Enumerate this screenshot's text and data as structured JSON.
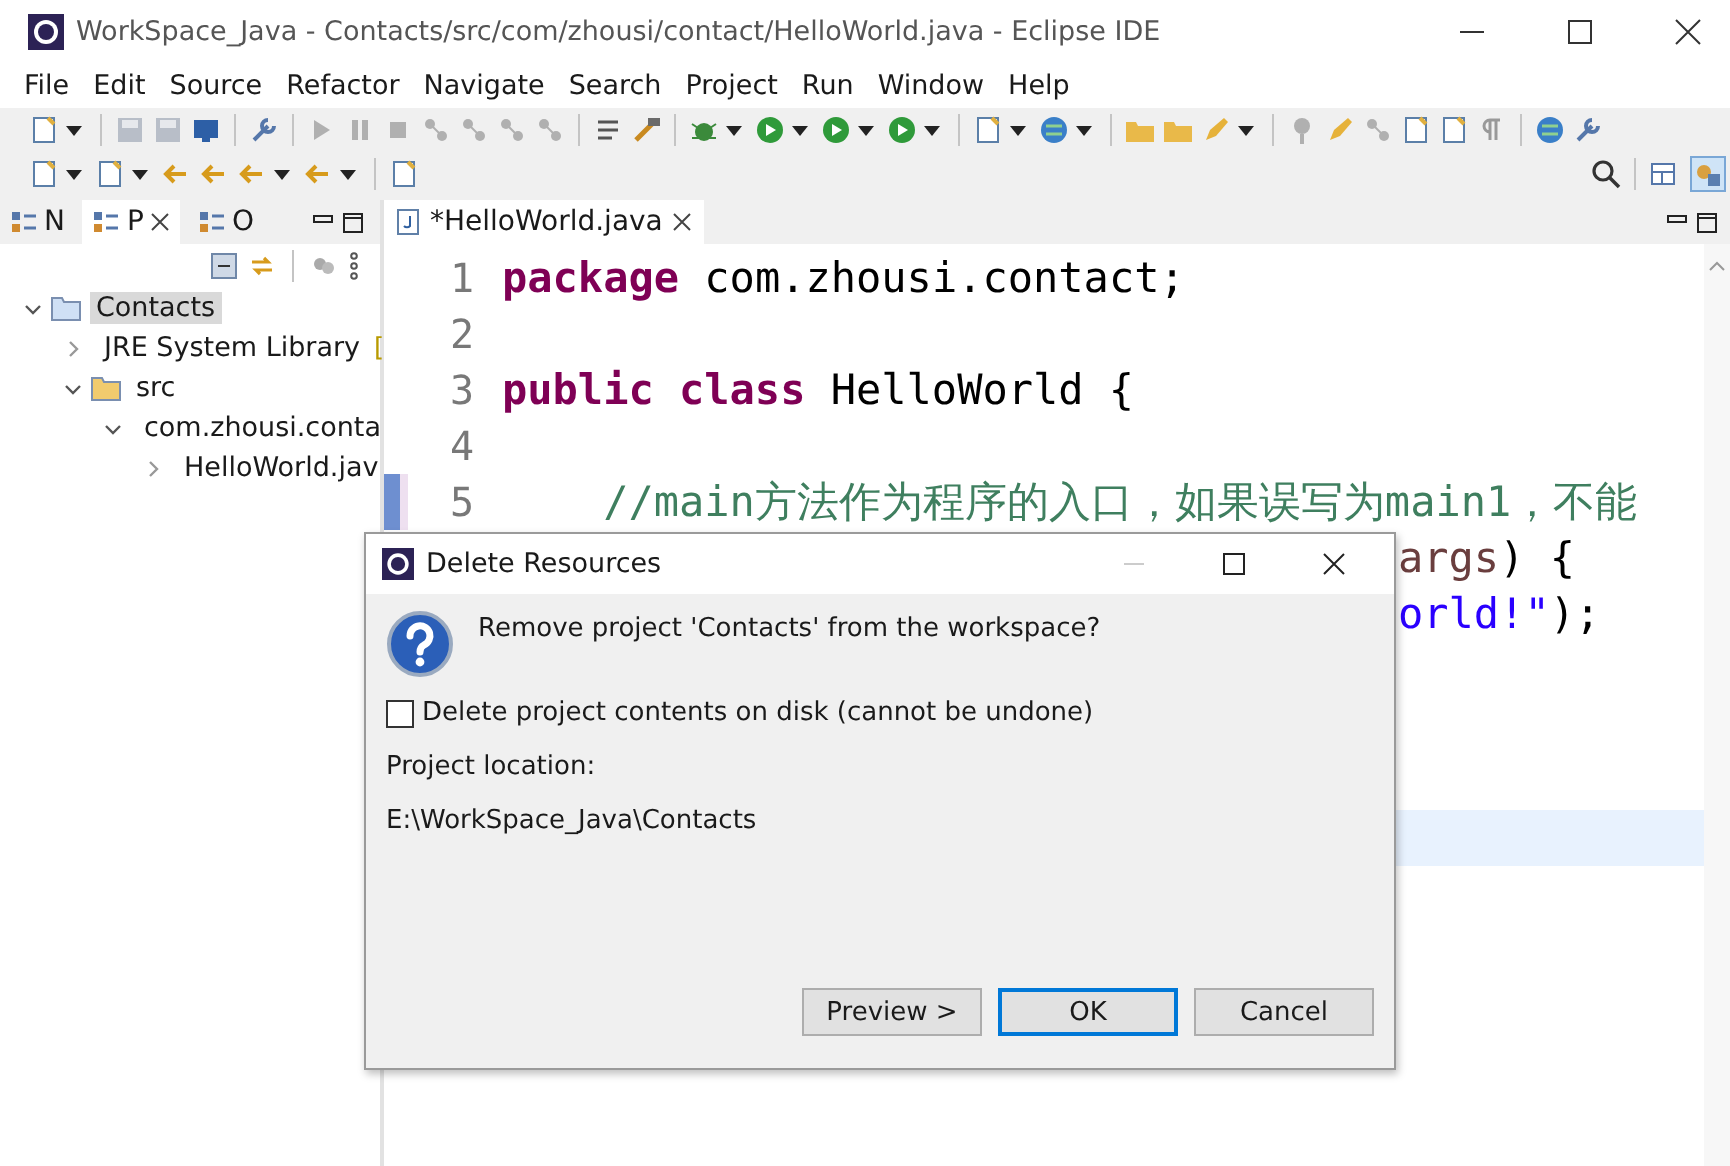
{
  "window": {
    "title": "WorkSpace_Java - Contacts/src/com/zhousi/contact/HelloWorld.java - Eclipse IDE"
  },
  "menu": [
    "File",
    "Edit",
    "Source",
    "Refactor",
    "Navigate",
    "Search",
    "Project",
    "Run",
    "Window",
    "Help"
  ],
  "left_panel": {
    "tabs": [
      {
        "label": "N",
        "selected": false
      },
      {
        "label": "P",
        "selected": true
      },
      {
        "label": "O",
        "selected": false
      }
    ],
    "tree": [
      {
        "label": "Contacts",
        "kind": "project",
        "expanded": true,
        "selected": true,
        "children": [
          {
            "label": "JRE System Library",
            "suffix": "[",
            "kind": "library",
            "expanded": false,
            "selected": false
          },
          {
            "label": "src",
            "kind": "folder",
            "expanded": true,
            "selected": false,
            "children": [
              {
                "label": "com.zhousi.conta",
                "kind": "package",
                "expanded": true,
                "selected": false,
                "children": [
                  {
                    "label": "HelloWorld.jav",
                    "kind": "file",
                    "expanded": false,
                    "selected": false
                  }
                ]
              }
            ]
          }
        ]
      }
    ]
  },
  "editor": {
    "tab": {
      "label": "*HelloWorld.java"
    },
    "lines": [
      {
        "number": "1",
        "kind": "full",
        "current": false,
        "tokens": [
          {
            "text": "package",
            "kind": "keyword"
          },
          {
            "text": " com.zhousi.contact;",
            "kind": "plain"
          }
        ]
      },
      {
        "number": "2",
        "kind": "full",
        "current": false
      },
      {
        "number": "3",
        "kind": "full",
        "current": false,
        "tokens": [
          {
            "text": "public class",
            "kind": "keyword"
          },
          {
            "text": " HelloWorld {",
            "kind": "plain"
          }
        ]
      },
      {
        "number": "4",
        "kind": "full",
        "current": false
      },
      {
        "number": "5",
        "kind": "full",
        "current": false,
        "marked": true,
        "tokens": [
          {
            "text": "    //main方法作为程序的入口，如果误写为main1，不能",
            "kind": "comment"
          }
        ]
      },
      {
        "kind": "partial",
        "current": false,
        "tokens": [
          {
            "text": "args",
            "kind": "param"
          },
          {
            "text": ") {",
            "kind": "plain"
          }
        ]
      },
      {
        "kind": "partial",
        "current": false,
        "tokens": [
          {
            "text": "orld!\"",
            "kind": "string"
          },
          {
            "text": ");",
            "kind": "plain"
          }
        ]
      },
      {
        "kind": "partial",
        "current": false
      },
      {
        "kind": "partial",
        "current": false
      },
      {
        "kind": "partial",
        "current": false
      },
      {
        "kind": "partial",
        "current": true
      }
    ]
  },
  "dialog": {
    "title": "Delete Resources",
    "message": "Remove project 'Contacts' from the workspace?",
    "checkbox": {
      "label": "Delete project contents on disk (cannot be undone)",
      "checked": false
    },
    "location_label": "Project location:",
    "location": "E:\\WorkSpace_Java\\Contacts",
    "buttons": [
      {
        "label": "Preview >",
        "default": false
      },
      {
        "label": "OK",
        "default": true
      },
      {
        "label": "Cancel",
        "default": false
      }
    ]
  }
}
